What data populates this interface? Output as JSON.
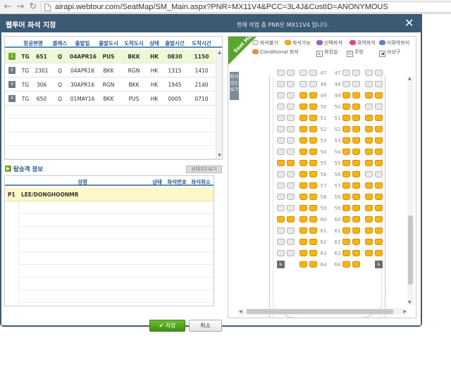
{
  "browser": {
    "url": "airapi.webtour.com/SeatMap/SM_Main.aspx?PNR=MX11V4&PCC=3L4J&CustID=ANONYMOUS",
    "back_icon": "back-arrow-icon",
    "forward_icon": "forward-arrow-icon",
    "reload_icon": "reload-icon"
  },
  "dialog": {
    "title": "웹투어 좌석 지정",
    "notice": "현재 작업 중 PNR은 MX11V4 입니다.",
    "close_label": "✕"
  },
  "flights": {
    "headers": [
      "항공편명",
      "클래스",
      "출발일",
      "출발도시",
      "도착도시",
      "상태",
      "출발시간",
      "도착시간"
    ],
    "rows": [
      {
        "seq": "1",
        "airline": "TG",
        "flight": "651",
        "class": "Q",
        "date": "04APR16",
        "from": "PUS",
        "to": "BKK",
        "status": "HK",
        "dep": "0830",
        "arr": "1150"
      },
      {
        "seq": "2",
        "airline": "TG",
        "flight": "2301",
        "class": "Q",
        "date": "04APR16",
        "from": "BKK",
        "to": "RGN",
        "status": "HK",
        "dep": "1315",
        "arr": "1410"
      },
      {
        "seq": "3",
        "airline": "TG",
        "flight": "306",
        "class": "Q",
        "date": "30APR16",
        "from": "RGN",
        "to": "BKK",
        "status": "HK",
        "dep": "1945",
        "arr": "2140"
      },
      {
        "seq": "4",
        "airline": "TG",
        "flight": "650",
        "class": "Q",
        "date": "01MAY16",
        "from": "BKK",
        "to": "PUS",
        "status": "HK",
        "dep": "0005",
        "arr": "0710"
      }
    ]
  },
  "passengers": {
    "section_title": "탑승객 정보",
    "ssr_button": "상태코드보기",
    "headers": {
      "name": "성명",
      "status": "상태",
      "seat": "좌석번호",
      "cancel": "좌석취소"
    },
    "rows": [
      {
        "id": "P1",
        "name": "LEE/DONGHOONMR"
      }
    ]
  },
  "buttons": {
    "save": "저장",
    "cancel": "취소"
  },
  "seatmap": {
    "tab": "Seat Map",
    "side_tab": "좌석 코드 보기",
    "legend": {
      "unavailable": "좌석불가",
      "available": "좌석가능",
      "selected": "선택좌석",
      "confirmed": "확약좌석",
      "unconfirmed": "미확약좌석",
      "conditional": "Conditional 좌석",
      "lavatory": "화장실",
      "galley": "주방",
      "exit": "비상구"
    },
    "rows": [
      "47",
      "48",
      "49",
      "50",
      "51",
      "52",
      "53",
      "54",
      "55",
      "56",
      "57",
      "58",
      "59",
      "60",
      "61",
      "62",
      "63",
      "64"
    ],
    "colors": {
      "available": "#f5b417",
      "unavailable": "#e9e9e9",
      "selected": "#a05bd6",
      "confirmed": "#e0468a",
      "unconfirmed": "#5b83c9",
      "conditional": "#ef8c3a"
    }
  }
}
